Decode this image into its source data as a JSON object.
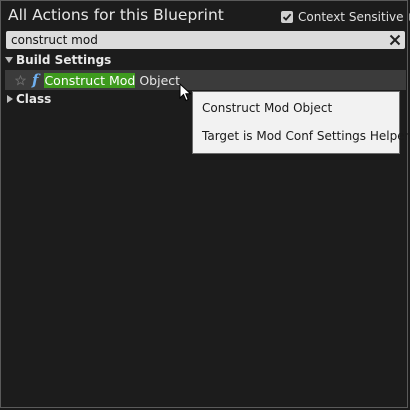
{
  "header": {
    "title": "All Actions for this Blueprint",
    "context_sensitive_label": "Context Sensitive",
    "context_sensitive_checked": true
  },
  "search": {
    "value": "construct mod"
  },
  "tree": {
    "categories": [
      {
        "label": "Build Settings",
        "expanded": true,
        "items": [
          {
            "icon": "function-icon",
            "highlight": "Construct Mod",
            "rest": " Object",
            "selected": true
          }
        ]
      },
      {
        "label": "Class",
        "expanded": false
      }
    ]
  },
  "tooltip": {
    "line1": "Construct Mod Object",
    "line2": "Target is Mod Conf Settings Helper"
  },
  "colors": {
    "highlight": "#3e9a1e",
    "function_icon": "#6fb0f0",
    "background": "#1c1c1c"
  }
}
